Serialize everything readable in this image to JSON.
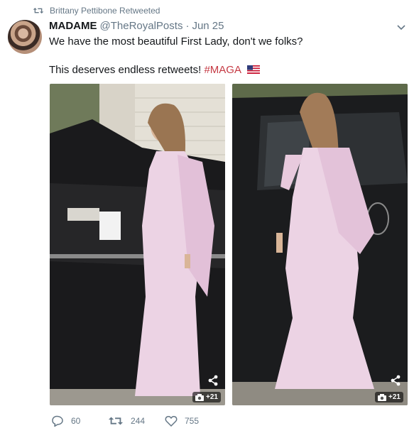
{
  "retweet_context": {
    "text": "Brittany Pettibone Retweeted"
  },
  "tweet": {
    "author_name": "MADAME",
    "author_handle": "@TheRoyalPosts",
    "separator": "·",
    "date": "Jun 25",
    "text_line1": "We have the most beautiful First Lady, don't we folks?",
    "text_line2": "This deserves endless retweets!",
    "hashtag": "#MAGA",
    "hashtag_color": "#c53a44"
  },
  "media": {
    "left_photo": {
      "badge": "+21"
    },
    "right_photo": {
      "badge": "+21"
    }
  },
  "actions": {
    "replies": "60",
    "retweets": "244",
    "likes": "755"
  },
  "colors": {
    "muted": "#657786",
    "text": "#14171a",
    "dress": "#e9cfe0"
  }
}
